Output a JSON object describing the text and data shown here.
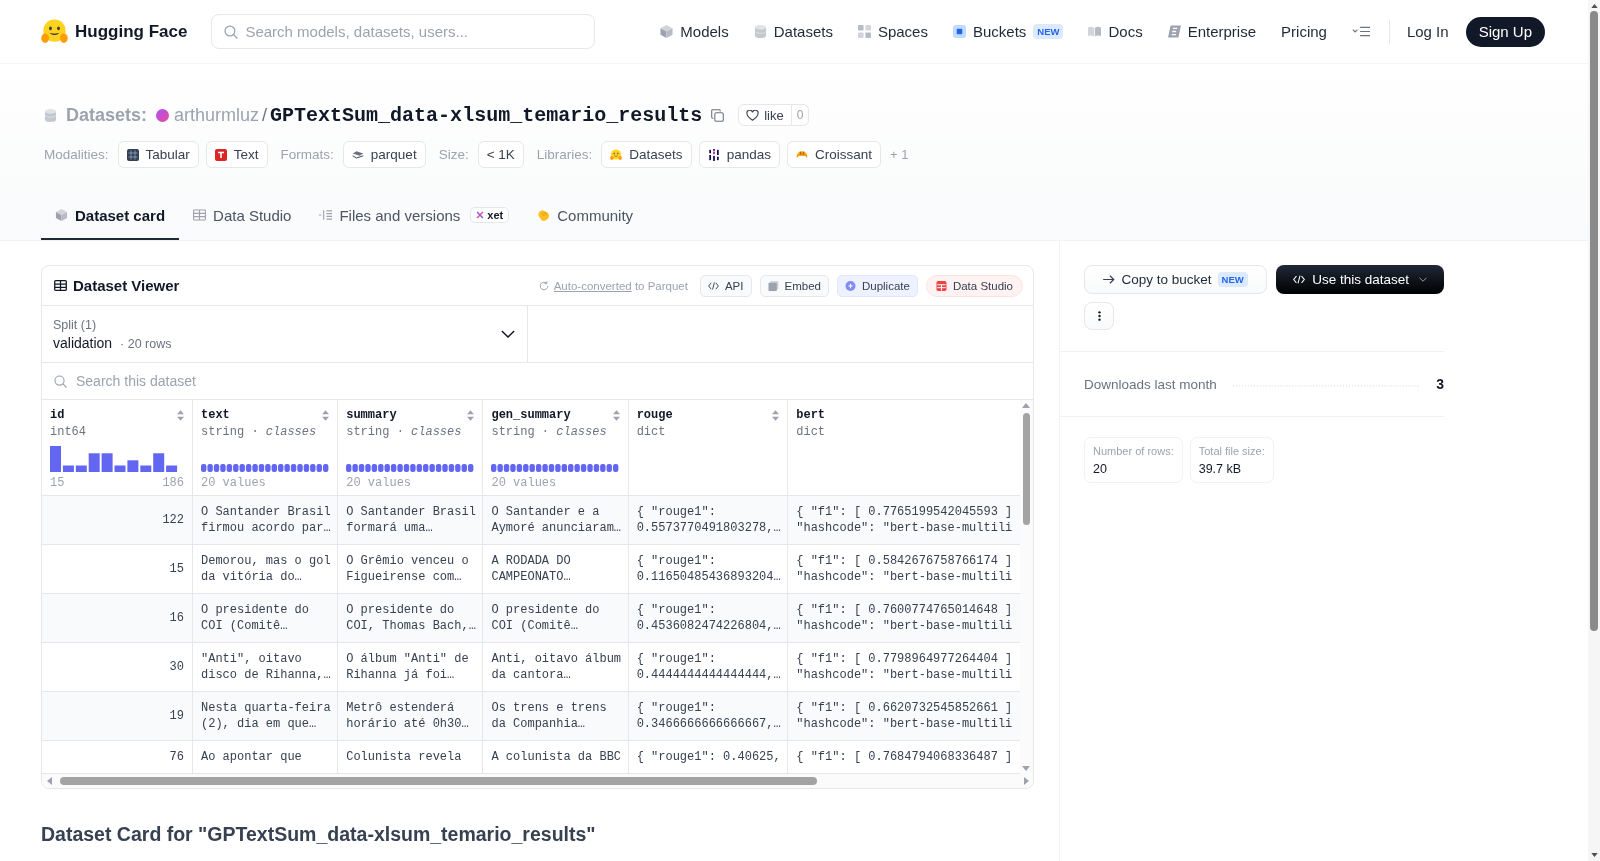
{
  "header": {
    "brand": "Hugging Face",
    "search": {
      "placeholder": "Search models, datasets, users..."
    },
    "nav": [
      {
        "label": "Models"
      },
      {
        "label": "Datasets"
      },
      {
        "label": "Spaces"
      },
      {
        "label": "Buckets",
        "badge": "NEW"
      },
      {
        "label": "Docs"
      },
      {
        "label": "Enterprise"
      },
      {
        "label": "Pricing"
      }
    ],
    "login": "Log In",
    "signup": "Sign Up"
  },
  "repo": {
    "type": "Datasets:",
    "owner": "arthurmluz",
    "separator": "/",
    "name": "GPTextSum_data-xlsum_temario_results",
    "like": {
      "label": "like",
      "count": "0"
    }
  },
  "tag_groups": [
    {
      "label": "Modalities:",
      "tags": [
        "Tabular",
        "Text"
      ]
    },
    {
      "label": "Formats:",
      "tags": [
        "parquet"
      ]
    },
    {
      "label": "Size:",
      "tags": [
        "< 1K"
      ]
    },
    {
      "label": "Libraries:",
      "tags": [
        "Datasets",
        "pandas",
        "Croissant"
      ],
      "more": "+ 1"
    }
  ],
  "tabs": [
    {
      "label": "Dataset card",
      "selected": true
    },
    {
      "label": "Data Studio",
      "selected": false
    },
    {
      "label": "Files and versions",
      "selected": false,
      "badge": "xet"
    },
    {
      "label": "Community",
      "selected": false
    }
  ],
  "viewer": {
    "title": "Dataset Viewer",
    "note": {
      "link": "Auto-converted",
      "text": "to Parquet"
    },
    "actions": [
      {
        "label": "API",
        "kind": "api"
      },
      {
        "label": "Embed",
        "kind": "embed"
      },
      {
        "label": "Duplicate",
        "kind": "duplicate"
      },
      {
        "label": "Data Studio",
        "kind": "studio"
      }
    ],
    "split": {
      "label": "Split (1)",
      "value": "validation",
      "separator": "·",
      "count": "20 rows"
    },
    "search": {
      "placeholder": "Search this dataset"
    },
    "columns": [
      {
        "name": "id",
        "type": "int64",
        "kind": "histogram",
        "min": "15",
        "max": "186",
        "sortable": true
      },
      {
        "name": "text",
        "type": "string · *classes*",
        "kind": "classes",
        "caption": "20 values",
        "sortable": true
      },
      {
        "name": "summary",
        "type": "string · *classes*",
        "kind": "classes",
        "caption": "20 values",
        "sortable": true
      },
      {
        "name": "gen_summary",
        "type": "string · *classes*",
        "kind": "classes",
        "caption": "20 values",
        "sortable": true
      },
      {
        "name": "rouge",
        "type": "dict",
        "kind": "dict",
        "sortable": true
      },
      {
        "name": "bert",
        "type": "dict",
        "kind": "dict",
        "sortable": false
      }
    ],
    "rows": [
      [
        "122",
        "O Santander Brasil firmou acordo par…",
        "O Santander Brasil formará uma…",
        "O Santander e a Aymoré anunciaram…",
        "{ \"rouge1\": 0.5573770491803278,…",
        "{ \"f1\": [ 0.7765199542045593 ] \"hashcode\": \"bert-base-multili"
      ],
      [
        "15",
        "Demorou, mas o gol da vitória do…",
        "O Grêmio venceu o Figueirense com…",
        "A RODADA DO CAMPEONATO…",
        "{ \"rouge1\": 0.11650485436893204…",
        "{ \"f1\": [ 0.5842676758766174 ] \"hashcode\": \"bert-base-multili"
      ],
      [
        "16",
        "O presidente do COI (Comitê…",
        "O presidente do COI, Thomas Bach,…",
        "O presidente do COI (Comitê…",
        "{ \"rouge1\": 0.4536082474226804,…",
        "{ \"f1\": [ 0.7600774765014648 ] \"hashcode\": \"bert-base-multili"
      ],
      [
        "30",
        "\"Anti\", oitavo disco de Rihanna,…",
        "O álbum \"Anti\" de Rihanna já foi…",
        "Anti, oitavo álbum da cantora…",
        "{ \"rouge1\": 0.4444444444444444,…",
        "{ \"f1\": [ 0.7798964977264404 ] \"hashcode\": \"bert-base-multili"
      ],
      [
        "19",
        "Nesta quarta-feira (2), dia em que…",
        "Metrô estenderá horário até 0h30…",
        "Os trens e trens da Companhia…",
        "{ \"rouge1\": 0.3466666666666667,…",
        "{ \"f1\": [ 0.6620732545852661 ] \"hashcode\": \"bert-base-multili"
      ],
      [
        "76",
        "Ao apontar que",
        "Colunista revela",
        "A colunista da BBC",
        "{ \"rouge1\": 0.40625,",
        "{ \"f1\": [ 0.7684794068336487 ]"
      ]
    ]
  },
  "card_title": "Dataset Card for \"GPTextSum_data-xlsum_temario_results\"",
  "sidebar": {
    "copy_button": {
      "label": "Copy to bucket",
      "badge": "NEW"
    },
    "use_button": "Use this dataset",
    "downloads": {
      "label": "Downloads last month",
      "value": "3"
    },
    "stats": [
      {
        "label": "Number of rows:",
        "value": "20"
      },
      {
        "label": "Total file size:",
        "value": "39.7 kB"
      }
    ]
  }
}
